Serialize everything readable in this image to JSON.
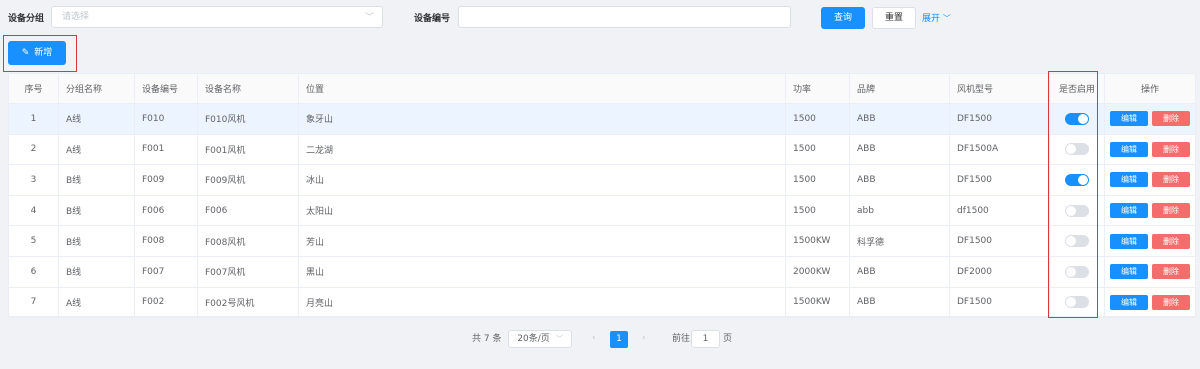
{
  "filters": {
    "group_label": "设备分组",
    "group_placeholder": "请选择",
    "code_label": "设备编号",
    "code_value": "",
    "search_label": "查询",
    "reset_label": "重置",
    "expand_label": "展开"
  },
  "toolbar": {
    "add_label": "新增"
  },
  "table": {
    "headers": {
      "index": "序号",
      "group": "分组名称",
      "code": "设备编号",
      "name": "设备名称",
      "location": "位置",
      "power": "功率",
      "brand": "品牌",
      "model": "风机型号",
      "enabled": "是否启用",
      "actions": "操作"
    },
    "rows": [
      {
        "index": "1",
        "group": "A线",
        "code": "F010",
        "name": "F010风机",
        "location": "象牙山",
        "power": "1500",
        "brand": "ABB",
        "model": "DF1500",
        "enabled": true
      },
      {
        "index": "2",
        "group": "A线",
        "code": "F001",
        "name": "F001风机",
        "location": "二龙湖",
        "power": "1500",
        "brand": "ABB",
        "model": "DF1500A",
        "enabled": false
      },
      {
        "index": "3",
        "group": "B线",
        "code": "F009",
        "name": "F009风机",
        "location": "冰山",
        "power": "1500",
        "brand": "ABB",
        "model": "DF1500",
        "enabled": true
      },
      {
        "index": "4",
        "group": "B线",
        "code": "F006",
        "name": "F006",
        "location": "太阳山",
        "power": "1500",
        "brand": "abb",
        "model": "df1500",
        "enabled": false
      },
      {
        "index": "5",
        "group": "B线",
        "code": "F008",
        "name": "F008风机",
        "location": "芳山",
        "power": "1500KW",
        "brand": "科孚德",
        "model": "DF1500",
        "enabled": false
      },
      {
        "index": "6",
        "group": "B线",
        "code": "F007",
        "name": "F007风机",
        "location": "黑山",
        "power": "2000KW",
        "brand": "ABB",
        "model": "DF2000",
        "enabled": false
      },
      {
        "index": "7",
        "group": "A线",
        "code": "F002",
        "name": "F002号风机",
        "location": "月亮山",
        "power": "1500KW",
        "brand": "ABB",
        "model": "DF1500",
        "enabled": false
      }
    ],
    "edit_label": "编辑",
    "delete_label": "删除"
  },
  "pagination": {
    "total_text": "共 7 条",
    "page_size": "20条/页",
    "current_page": "1",
    "goto_prefix": "前往",
    "goto_value": "1",
    "goto_suffix": "页"
  },
  "colors": {
    "primary": "#1890ff",
    "danger": "#f56c6c",
    "highlight_border": "#d9363e"
  }
}
